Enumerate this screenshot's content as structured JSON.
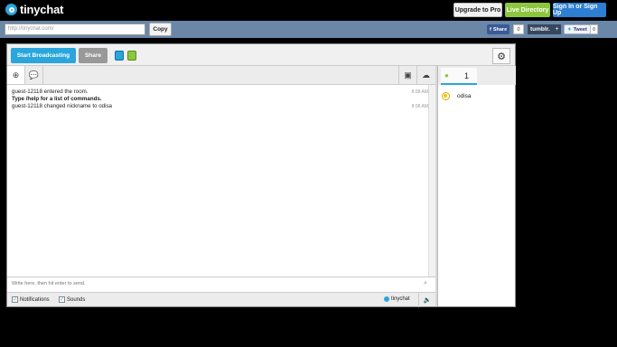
{
  "header": {
    "logo_text": "tinychat",
    "upgrade_label": "Upgrade to Pro",
    "live_label": "Live Directory",
    "sign_label": "Sign In or Sign Up"
  },
  "urlbar": {
    "url_value": "http://tinychat.com/",
    "copy_label": "Copy",
    "fb_share_label": "Share",
    "fb_count": "0",
    "tumblr_label": "tumblr.",
    "tumblr_plus": "+",
    "tweet_label": "Tweet",
    "tweet_count": "0"
  },
  "toolbar": {
    "broadcast_label": "Start Broadcasting",
    "share_label": "Share"
  },
  "chat": {
    "messages": [
      {
        "text": "guest-12118 entered the room.",
        "time": "8:08 AM"
      },
      {
        "text": "Type /help for a list of commands.",
        "time": ""
      },
      {
        "text": "guest-12118 changed nickname to odisa",
        "time": "8:08 AM"
      }
    ],
    "input_placeholder": "Write here, then hit enter to send.",
    "notifications_label": "Notifications",
    "sounds_label": "Sounds",
    "brand_label": "tinychat"
  },
  "users": {
    "count": "1",
    "list": [
      "odisa"
    ]
  }
}
